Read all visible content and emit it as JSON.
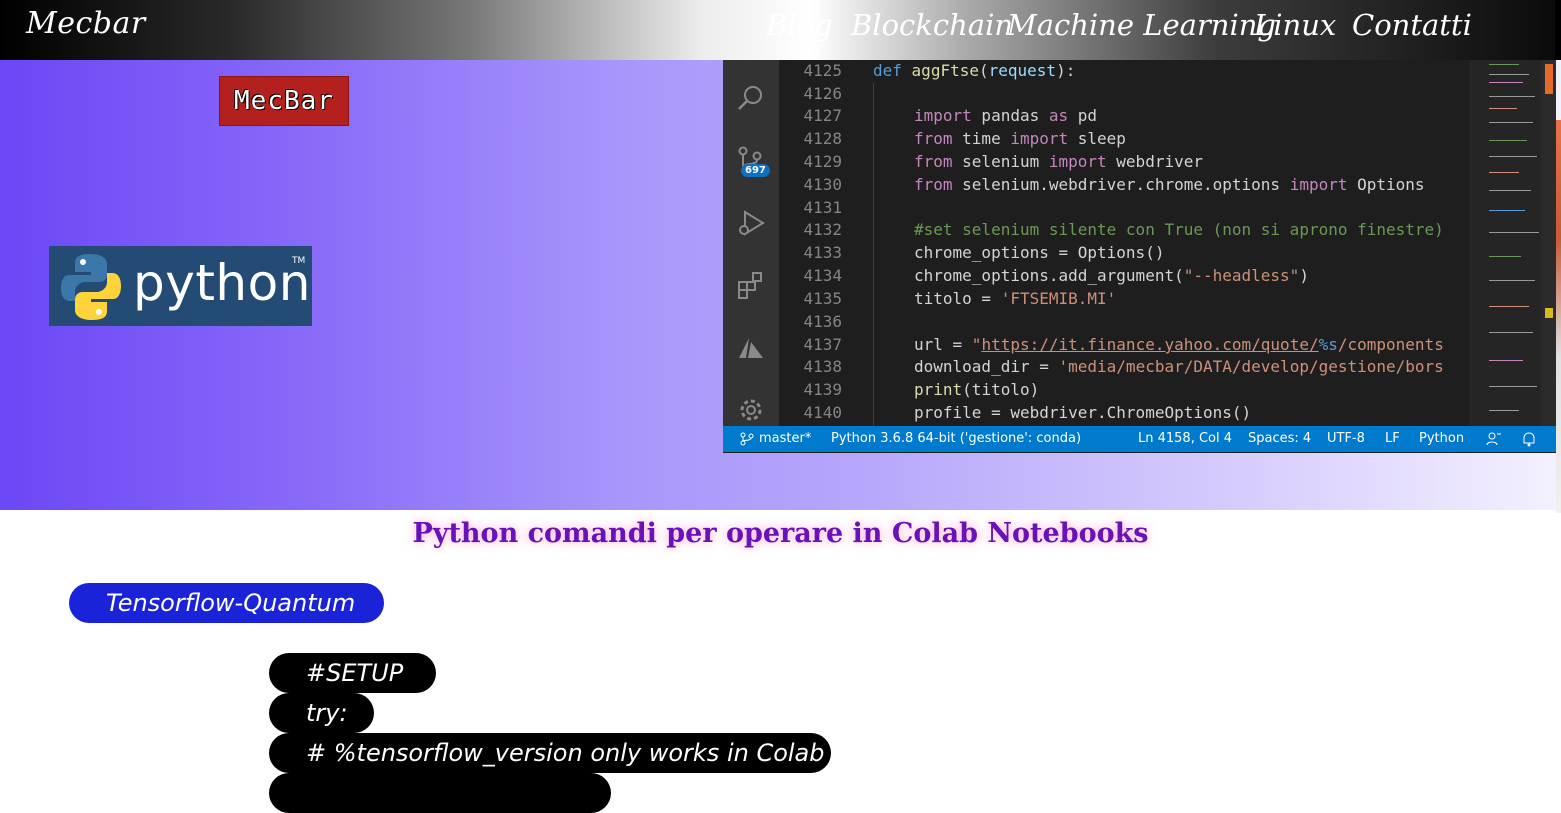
{
  "nav": {
    "brand": "Mecbar",
    "items": [
      {
        "label": "Blog"
      },
      {
        "label": "Blockchain"
      },
      {
        "label": "Machine Learning"
      },
      {
        "label": "Linux"
      },
      {
        "label": "Contatti"
      }
    ]
  },
  "hero": {
    "logo_text": "MecBar",
    "python_word": "python",
    "python_tm": "TM"
  },
  "editor": {
    "scm_badge": "697",
    "lines": [
      {
        "n": "4125"
      },
      {
        "n": "4126"
      },
      {
        "n": "4127"
      },
      {
        "n": "4128"
      },
      {
        "n": "4129"
      },
      {
        "n": "4130"
      },
      {
        "n": "4131"
      },
      {
        "n": "4132"
      },
      {
        "n": "4133"
      },
      {
        "n": "4134"
      },
      {
        "n": "4135"
      },
      {
        "n": "4136"
      },
      {
        "n": "4137"
      },
      {
        "n": "4138"
      },
      {
        "n": "4139"
      },
      {
        "n": "4140"
      }
    ],
    "code": {
      "l1": {
        "kw": "def",
        "fn": "aggFtse",
        "p1": "(",
        "param": "request",
        "p2": "):"
      },
      "l3": {
        "k1": "import",
        "t1": " pandas ",
        "k2": "as",
        "t2": " pd"
      },
      "l4": {
        "k1": "from",
        "t1": " time ",
        "k2": "import",
        "t2": " sleep"
      },
      "l5": {
        "k1": "from",
        "t1": " selenium ",
        "k2": "import",
        "t2": " webdriver"
      },
      "l6": {
        "k1": "from",
        "t1": " selenium.webdriver.chrome.options ",
        "k2": "import",
        "t2": " Options"
      },
      "l8": {
        "comment": "#set selenium silente con True (non si aprono finestre)"
      },
      "l9": {
        "t1": "chrome_options = Options()"
      },
      "l10": {
        "t1": "chrome_options.add_argument(",
        "s": "\"--headless\"",
        "t2": ")"
      },
      "l11": {
        "t1": "titolo = ",
        "s": "'FTSEMIB.MI'"
      },
      "l13": {
        "t1": "url = ",
        "s1": "\"",
        "link": "https://it.finance.yahoo.com/quote/",
        "f": "%s",
        "s2": "/components"
      },
      "l14": {
        "t1": "download_dir = ",
        "s": "'media/mecbar/DATA/develop/gestione/bors"
      },
      "l15": {
        "fn": "print",
        "t1": "(titolo)"
      },
      "l16": {
        "t1": "profile = webdriver.ChromeOptions()"
      }
    },
    "status": {
      "branch": "master*",
      "interpreter": "Python 3.6.8 64-bit ('gestione': conda)",
      "position": "Ln 4158, Col 4",
      "spaces": "Spaces: 4",
      "encoding": "UTF-8",
      "eol": "LF",
      "language": "Python"
    }
  },
  "content": {
    "title": "Python comandi per operare in Colab Notebooks",
    "section_pill": "Tensorflow-Quantum",
    "code_lines": [
      {
        "text": "#SETUP"
      },
      {
        "text": "try:"
      },
      {
        "text": "# %tensorflow_version only works in Colab"
      },
      {
        "text": ""
      }
    ]
  },
  "colors": {
    "accent_blue": "#1b23d8",
    "title_purple": "#6a12b9",
    "status_bar": "#007acc"
  }
}
